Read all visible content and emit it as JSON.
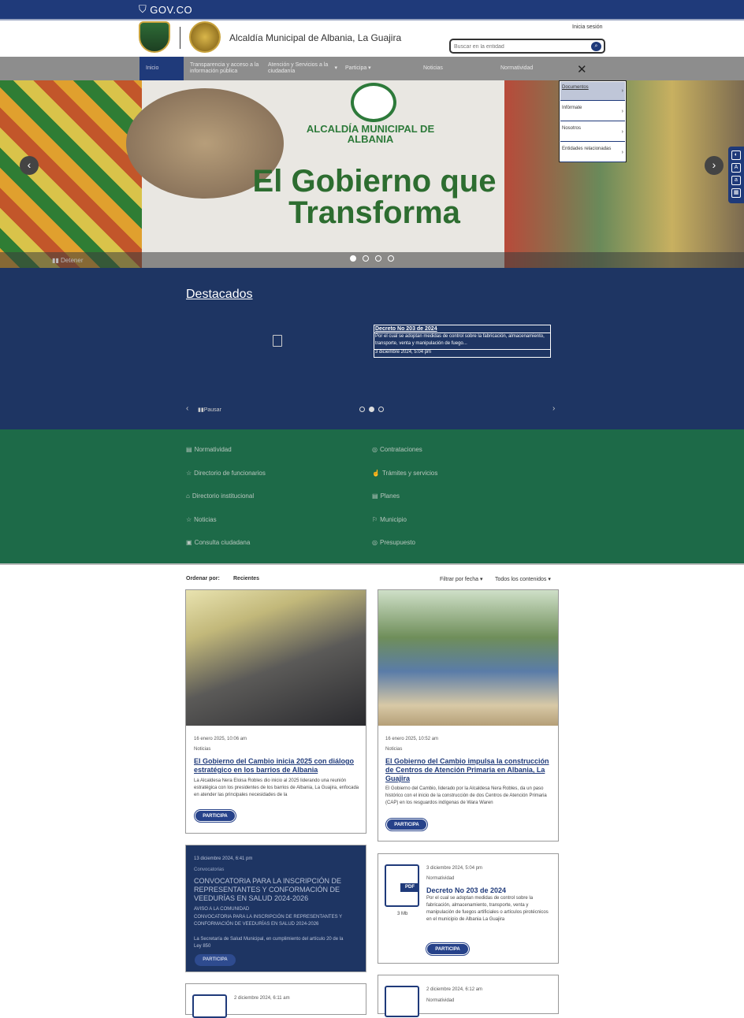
{
  "gov": {
    "logo": "GOV.CO"
  },
  "header": {
    "site_title": "Alcaldía Municipal de Albania, La Guajira",
    "login": "Inicia sesión",
    "search_placeholder": "Buscar en la entidad"
  },
  "nav": {
    "items": [
      "Inicio",
      "Transparencia y acceso a la información pública",
      "Atención y Servicios a la ciudadanía",
      "Participa",
      "Noticias",
      "Normatividad"
    ]
  },
  "menu": {
    "items": [
      "Documentos",
      "Infórmate",
      "Nosotros",
      "Entidades relacionadas"
    ]
  },
  "hero": {
    "subtitle": "ALCALDÍA MUNICIPAL DE ALBANIA",
    "title": "El Gobierno que Transforma",
    "stop_label": "Detener"
  },
  "featured": {
    "title": "Destacados",
    "item_title": "Decreto No 203 de 2024",
    "item_desc": "Por el cual se adoptan medidas de control sobre la fabricación, almacenamiento, transporte, venta y manipulación de fuego...",
    "item_date": "3 diciembre 2024, 5:04 pm",
    "pause_label": "Pausar"
  },
  "quick_links": [
    {
      "label": "Normatividad",
      "icon": "document-icon"
    },
    {
      "label": "Contrataciones",
      "icon": "coin-icon"
    },
    {
      "label": "Directorio de funcionarios",
      "icon": "star-icon"
    },
    {
      "label": "Trámites y servicios",
      "icon": "hand-icon"
    },
    {
      "label": "Directorio institucional",
      "icon": "building-icon"
    },
    {
      "label": "Planes",
      "icon": "list-icon"
    },
    {
      "label": "Noticias",
      "icon": "star-icon"
    },
    {
      "label": "Municipio",
      "icon": "flag-icon"
    },
    {
      "label": "Consulta ciudadana",
      "icon": "box-icon"
    },
    {
      "label": "Presupuesto",
      "icon": "coin-icon"
    }
  ],
  "sort": {
    "label": "Ordenar por:",
    "value": "Recientes",
    "filter_date": "Filtrar por fecha",
    "filter_content": "Todos los contenidos"
  },
  "cards": [
    {
      "date": "16 enero 2025, 10:06 am",
      "category": "Noticias",
      "title": "El Gobierno del Cambio inicia 2025 con diálogo estratégico en los barrios de Albania",
      "desc": "La Alcaldesa Nera Eloisa Robles dio inicio al 2025 liderando una reunión estratégica con los presidentes de los barrios de Albania, La Guajira, enfocada en atender las principales necesidades de la",
      "button": "PARTICIPA"
    },
    {
      "date": "16 enero 2025, 10:52 am",
      "category": "Noticias",
      "title": "El Gobierno del Cambio impulsa la construcción de Centros de Atención Primaria en Albania, La Guajira",
      "desc": "El Gobierno del Cambio, liderado por la Alcaldesa Nera Robles, da un paso histórico con el inicio de la construcción de dos Centros de Atención Primaria (CAP) en los resguardos indígenas de Wara Waren",
      "button": "PARTICIPA"
    },
    {
      "date": "13 diciembre 2024, 6:41 pm",
      "category": "Convocatorias",
      "title": "CONVOCATORIA PARA LA INSCRIPCIÓN DE REPRESENTANTES Y CONFORMACIÓN DE VEEDURÍAS EN SALUD 2024-2026",
      "desc_line1": "AVISO A LA COMUNIDAD",
      "desc_line2": "CONVOCATORIA PARA LA INSCRIPCIÓN DE REPRESENTANTES Y CONFORMACIÓN DE VEEDURÍAS EN SALUD 2024-2026",
      "desc_line3": "La Secretaría de Salud Municipal, en cumplimiento del artículo 20 de la Ley 850",
      "button": "PARTICIPA"
    },
    {
      "date": "3 diciembre 2024, 5:04 pm",
      "category": "Normatividad",
      "title": "Decreto No 203 de 2024",
      "desc": "Por el cual se adoptan medidas de control sobre la fabricación, almacenamiento, transporte, venta y manipulación de fuegos artificiales o artículos pirotécnicos en el municipio de Albania La Guajira",
      "file_size": "3 Mb",
      "file_type": "PDF",
      "button": "PARTICIPA"
    },
    {
      "date": "2 diciembre 2024, 6:11 am"
    },
    {
      "date": "2 diciembre 2024, 6:12 am",
      "category": "Normatividad"
    }
  ],
  "colors": {
    "primary": "#1f3a7a",
    "featured_bg": "#1e3563",
    "links_bg": "#1d6a48",
    "nav_bg": "#8d8d8d"
  }
}
